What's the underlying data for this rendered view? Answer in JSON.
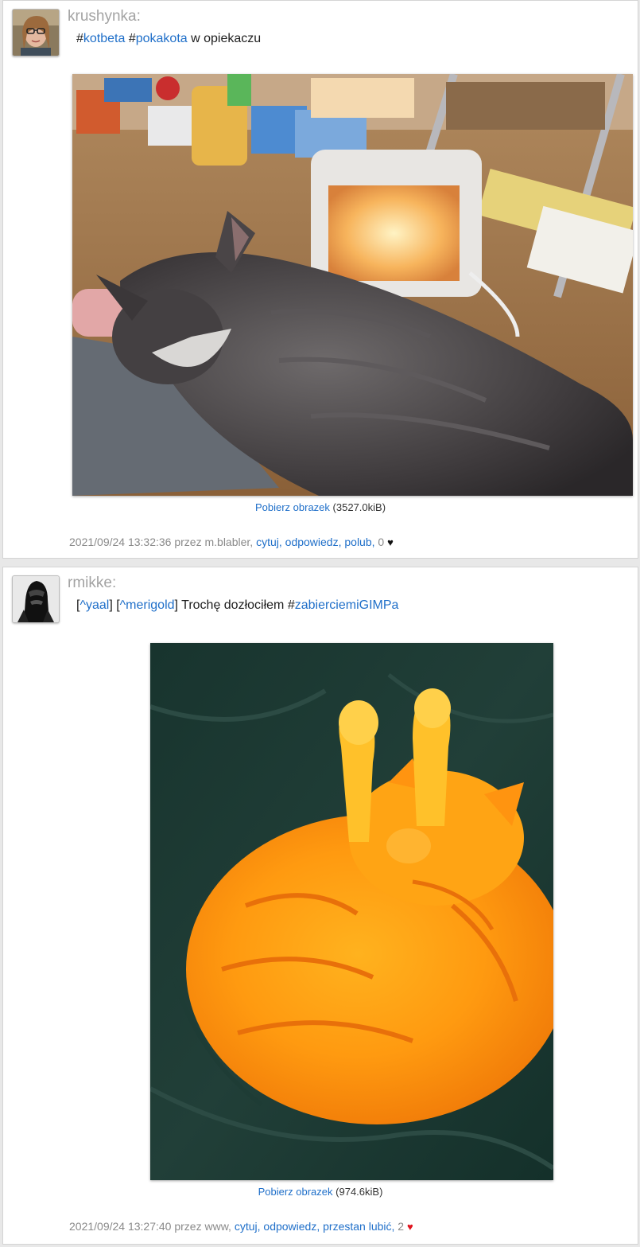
{
  "posts": [
    {
      "author": "krushynka:",
      "content_parts": [
        {
          "type": "text",
          "text": "#"
        },
        {
          "type": "link",
          "text": "kotbeta"
        },
        {
          "type": "text",
          "text": " #"
        },
        {
          "type": "link",
          "text": "pokakota"
        },
        {
          "type": "text",
          "text": " w opiekaczu"
        }
      ],
      "image_alt": "tabby cat lying in front of a glowing electric heater",
      "download_label": "Pobierz obrazek",
      "file_size": "(3527.0kiB)",
      "meta": {
        "timestamp": "2021/09/24 13:32:36",
        "by_text": "przez m.blabler,",
        "actions": [
          "cytuj,",
          "odpowiedz,",
          "polub,"
        ],
        "like_count": "0",
        "heart_icon": "heart-icon",
        "heart_color": "#111111"
      }
    },
    {
      "author": "rmikke:",
      "content_parts": [
        {
          "type": "text",
          "text": "["
        },
        {
          "type": "link",
          "text": "^yaal"
        },
        {
          "type": "text",
          "text": "] ["
        },
        {
          "type": "link",
          "text": "^merigold"
        },
        {
          "type": "text",
          "text": "] Trochę dozłociłem #"
        },
        {
          "type": "link",
          "text": "zabierciemiGIMPa"
        }
      ],
      "image_alt": "orange cat curled up on dark green blanket with paws raised",
      "download_label": "Pobierz obrazek",
      "file_size": "(974.6kiB)",
      "meta": {
        "timestamp": "2021/09/24 13:27:40",
        "by_text": "przez www,",
        "actions": [
          "cytuj,",
          "odpowiedz,",
          "przestan lubić,"
        ],
        "like_count": "2",
        "heart_icon": "heart-icon",
        "heart_color": "#e0141e"
      }
    }
  ]
}
